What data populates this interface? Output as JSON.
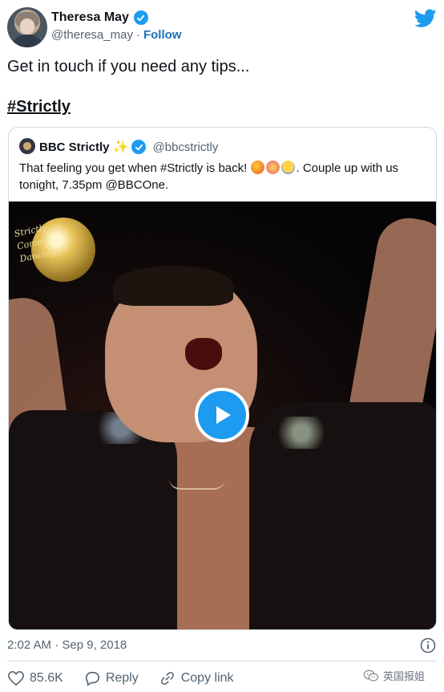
{
  "author": {
    "name": "Theresa May",
    "handle": "@theresa_may",
    "separator": "·",
    "follow_label": "Follow"
  },
  "tweet": {
    "text": "Get in touch if you need any tips...",
    "hashtag": "#Strictly",
    "timestamp": "2:02 AM · Sep 9, 2018"
  },
  "quoted": {
    "name": "BBC Strictly",
    "sparkle": "✨",
    "handle": "@bbcstrictly",
    "text_before": "That feeling you get when #Strictly is back! ",
    "text_after": ". Couple up with us tonight, 7.35pm @BBCOne.",
    "video_logo_text": [
      "Strictly",
      "Come",
      "Dancing"
    ]
  },
  "actions": {
    "like_count": "85.6K",
    "reply_label": "Reply",
    "copy_link_label": "Copy link"
  },
  "watermark": {
    "text": "英国报姐"
  },
  "colors": {
    "accent": "#1d9bf0",
    "follow": "#1d70b8",
    "muted": "#536471",
    "border": "#cfd9de"
  },
  "icons": [
    "verified-badge-icon",
    "twitter-bird-icon",
    "sparkles-emoji-icon",
    "play-icon",
    "info-icon",
    "heart-icon",
    "reply-icon",
    "link-icon",
    "wechat-icon"
  ]
}
